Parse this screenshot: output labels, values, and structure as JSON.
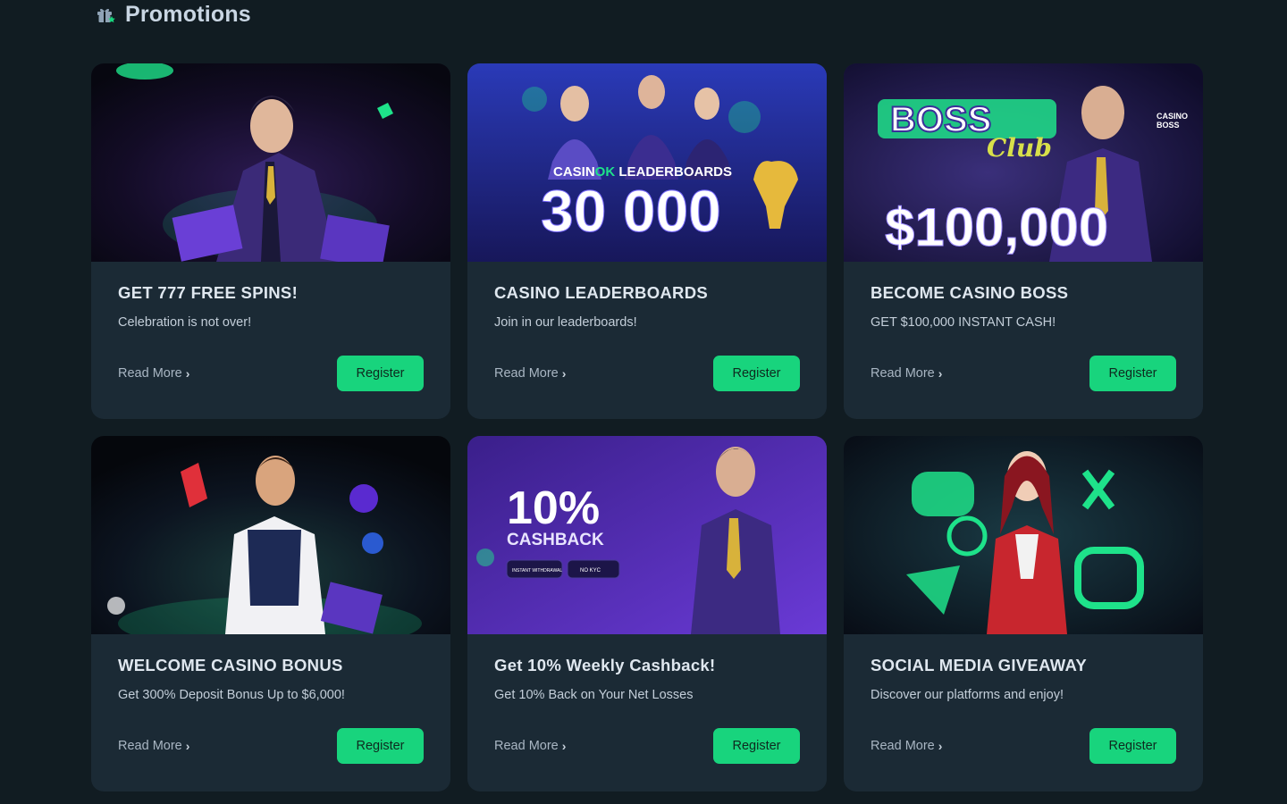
{
  "page": {
    "title": "Promotions",
    "accent": "#18d47d",
    "background": "#111c22",
    "card_background": "#1b2a35"
  },
  "promotions": [
    {
      "title": "GET 777 FREE SPINS!",
      "subtitle": "Celebration is not over!",
      "read_more": "Read More",
      "register": "Register"
    },
    {
      "title": "CASINO LEADERBOARDS",
      "subtitle": "Join in our leaderboards!",
      "read_more": "Read More",
      "register": "Register",
      "banner_text": {
        "brand_a": "CASIN",
        "brand_b": "OK",
        "brand_c": " LEADERBOARDS",
        "amount": "30 000"
      }
    },
    {
      "title": "BECOME CASINO BOSS",
      "subtitle": "GET $100,000 INSTANT CASH!",
      "read_more": "Read More",
      "register": "Register",
      "banner_text": {
        "logo": "BOSS",
        "script": "Club",
        "badge_a": "CASINO",
        "badge_b": "BOSS",
        "amount": "$100,000"
      }
    },
    {
      "title": "WELCOME CASINO BONUS",
      "subtitle": "Get 300% Deposit Bonus Up to $6,000!",
      "read_more": "Read More",
      "register": "Register"
    },
    {
      "title": "Get 10% Weekly Cashback!",
      "subtitle": "Get 10% Back on Your Net Losses",
      "read_more": "Read More",
      "register": "Register",
      "banner_text": {
        "percent": "10%",
        "label": "CASHBACK",
        "chip_a": "INSTANT WITHDRAWAL",
        "chip_b": "NO KYC"
      }
    },
    {
      "title": "SOCIAL MEDIA GIVEAWAY",
      "subtitle": "Discover our platforms and enjoy!",
      "read_more": "Read More",
      "register": "Register"
    }
  ]
}
